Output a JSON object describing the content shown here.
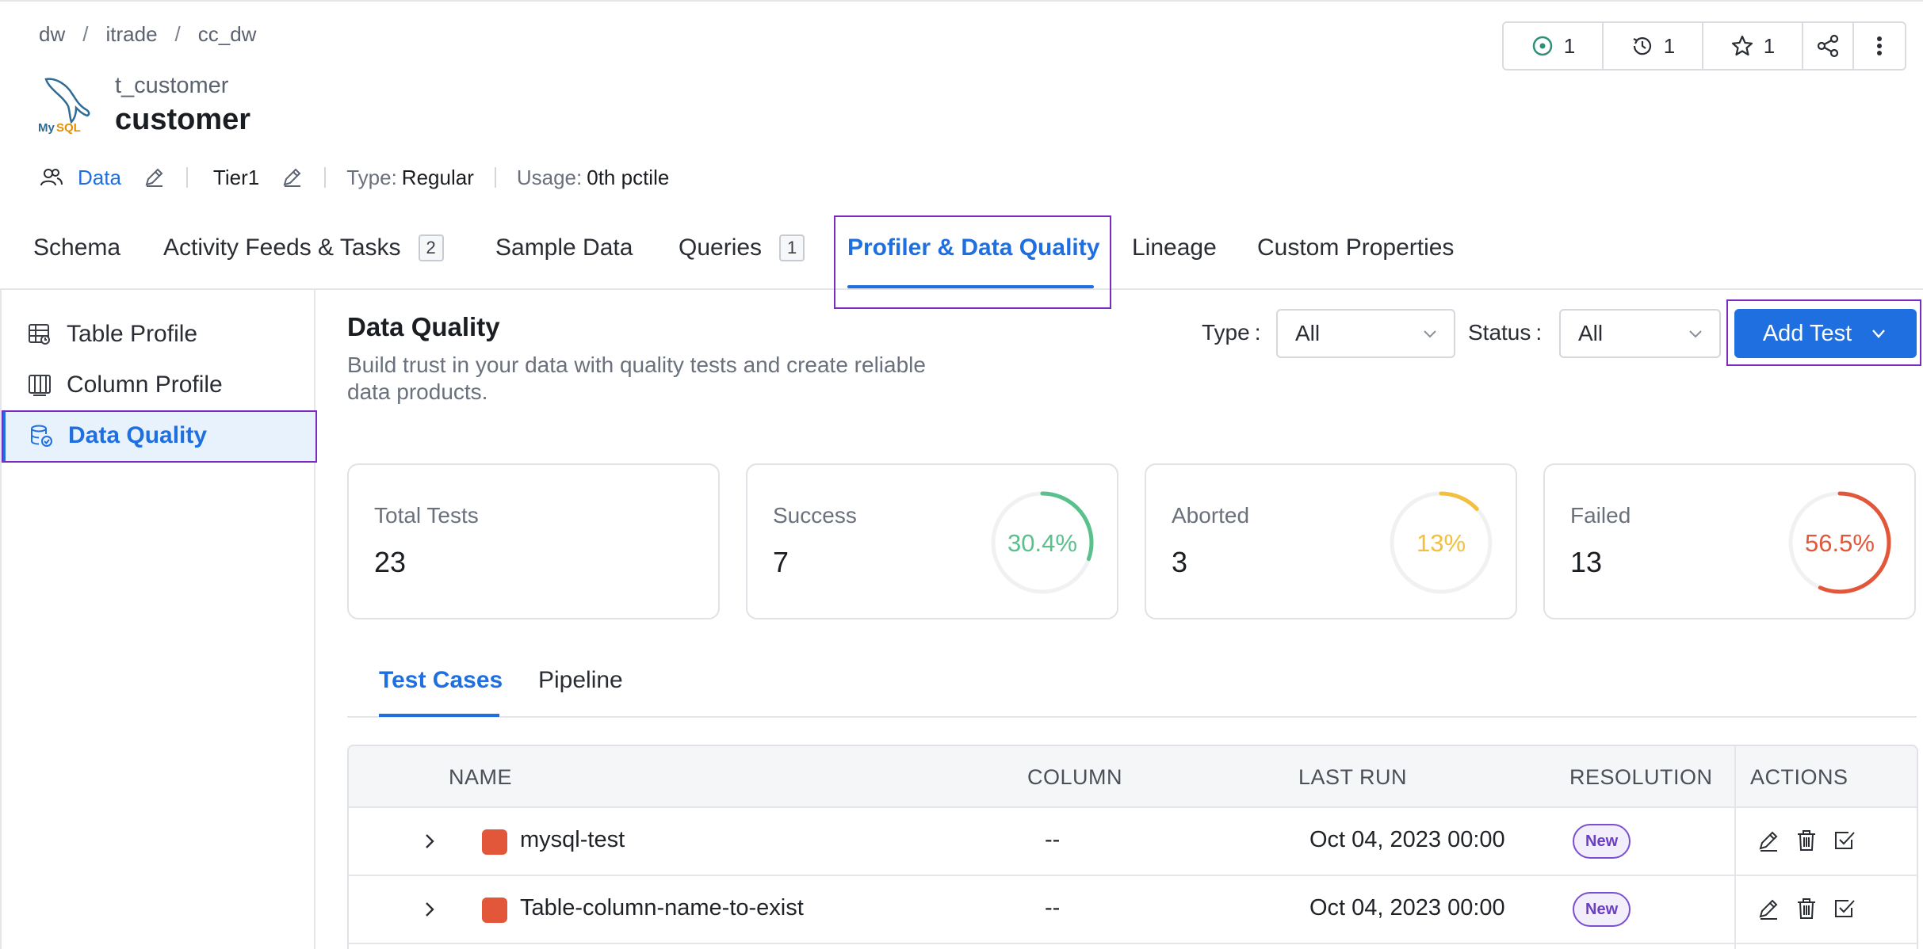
{
  "breadcrumb": [
    "dw",
    "itrade",
    "cc_dw"
  ],
  "entity": {
    "logo_text": "MySQL",
    "subtitle": "t_customer",
    "title": "customer"
  },
  "meta": {
    "owner": "Data",
    "tier": "Tier1",
    "type_label": "Type:",
    "type_value": "Regular",
    "usage_label": "Usage:",
    "usage_value": "0th pctile"
  },
  "header_actions": {
    "tasks_count": "1",
    "versions_count": "1",
    "followers_count": "1"
  },
  "tabs": [
    {
      "label": "Schema"
    },
    {
      "label": "Activity Feeds & Tasks",
      "count": "2"
    },
    {
      "label": "Sample Data"
    },
    {
      "label": "Queries",
      "count": "1"
    },
    {
      "label": "Profiler & Data Quality"
    },
    {
      "label": "Lineage"
    },
    {
      "label": "Custom Properties"
    }
  ],
  "sidebar": {
    "items": [
      {
        "label": "Table Profile"
      },
      {
        "label": "Column Profile"
      },
      {
        "label": "Data Quality"
      }
    ]
  },
  "data_quality": {
    "title": "Data Quality",
    "description": "Build trust in your data with quality tests and create reliable data products."
  },
  "filters": {
    "type_label": "Type",
    "type_value": "All",
    "status_label": "Status",
    "status_value": "All",
    "add_test_label": "Add Test"
  },
  "stats": [
    {
      "label": "Total Tests",
      "value": "23"
    },
    {
      "label": "Success",
      "value": "7",
      "percent": "30.4%",
      "fraction": 0.304,
      "color": "#5ac08c"
    },
    {
      "label": "Aborted",
      "value": "3",
      "percent": "13%",
      "fraction": 0.13,
      "color": "#f2c03e"
    },
    {
      "label": "Failed",
      "value": "13",
      "percent": "56.5%",
      "fraction": 0.565,
      "color": "#e2573a"
    }
  ],
  "sub_tabs": [
    "Test Cases",
    "Pipeline"
  ],
  "table": {
    "headers": [
      "NAME",
      "COLUMN",
      "LAST RUN",
      "RESOLUTION",
      "ACTIONS"
    ],
    "rows": [
      {
        "name": "mysql-test",
        "column": "--",
        "last_run": "Oct 04, 2023 00:00",
        "resolution": "New",
        "status_color": "#e2573a"
      },
      {
        "name": "Table-column-name-to-exist",
        "column": "--",
        "last_run": "Oct 04, 2023 00:00",
        "resolution": "New",
        "status_color": "#e2573a"
      }
    ]
  }
}
